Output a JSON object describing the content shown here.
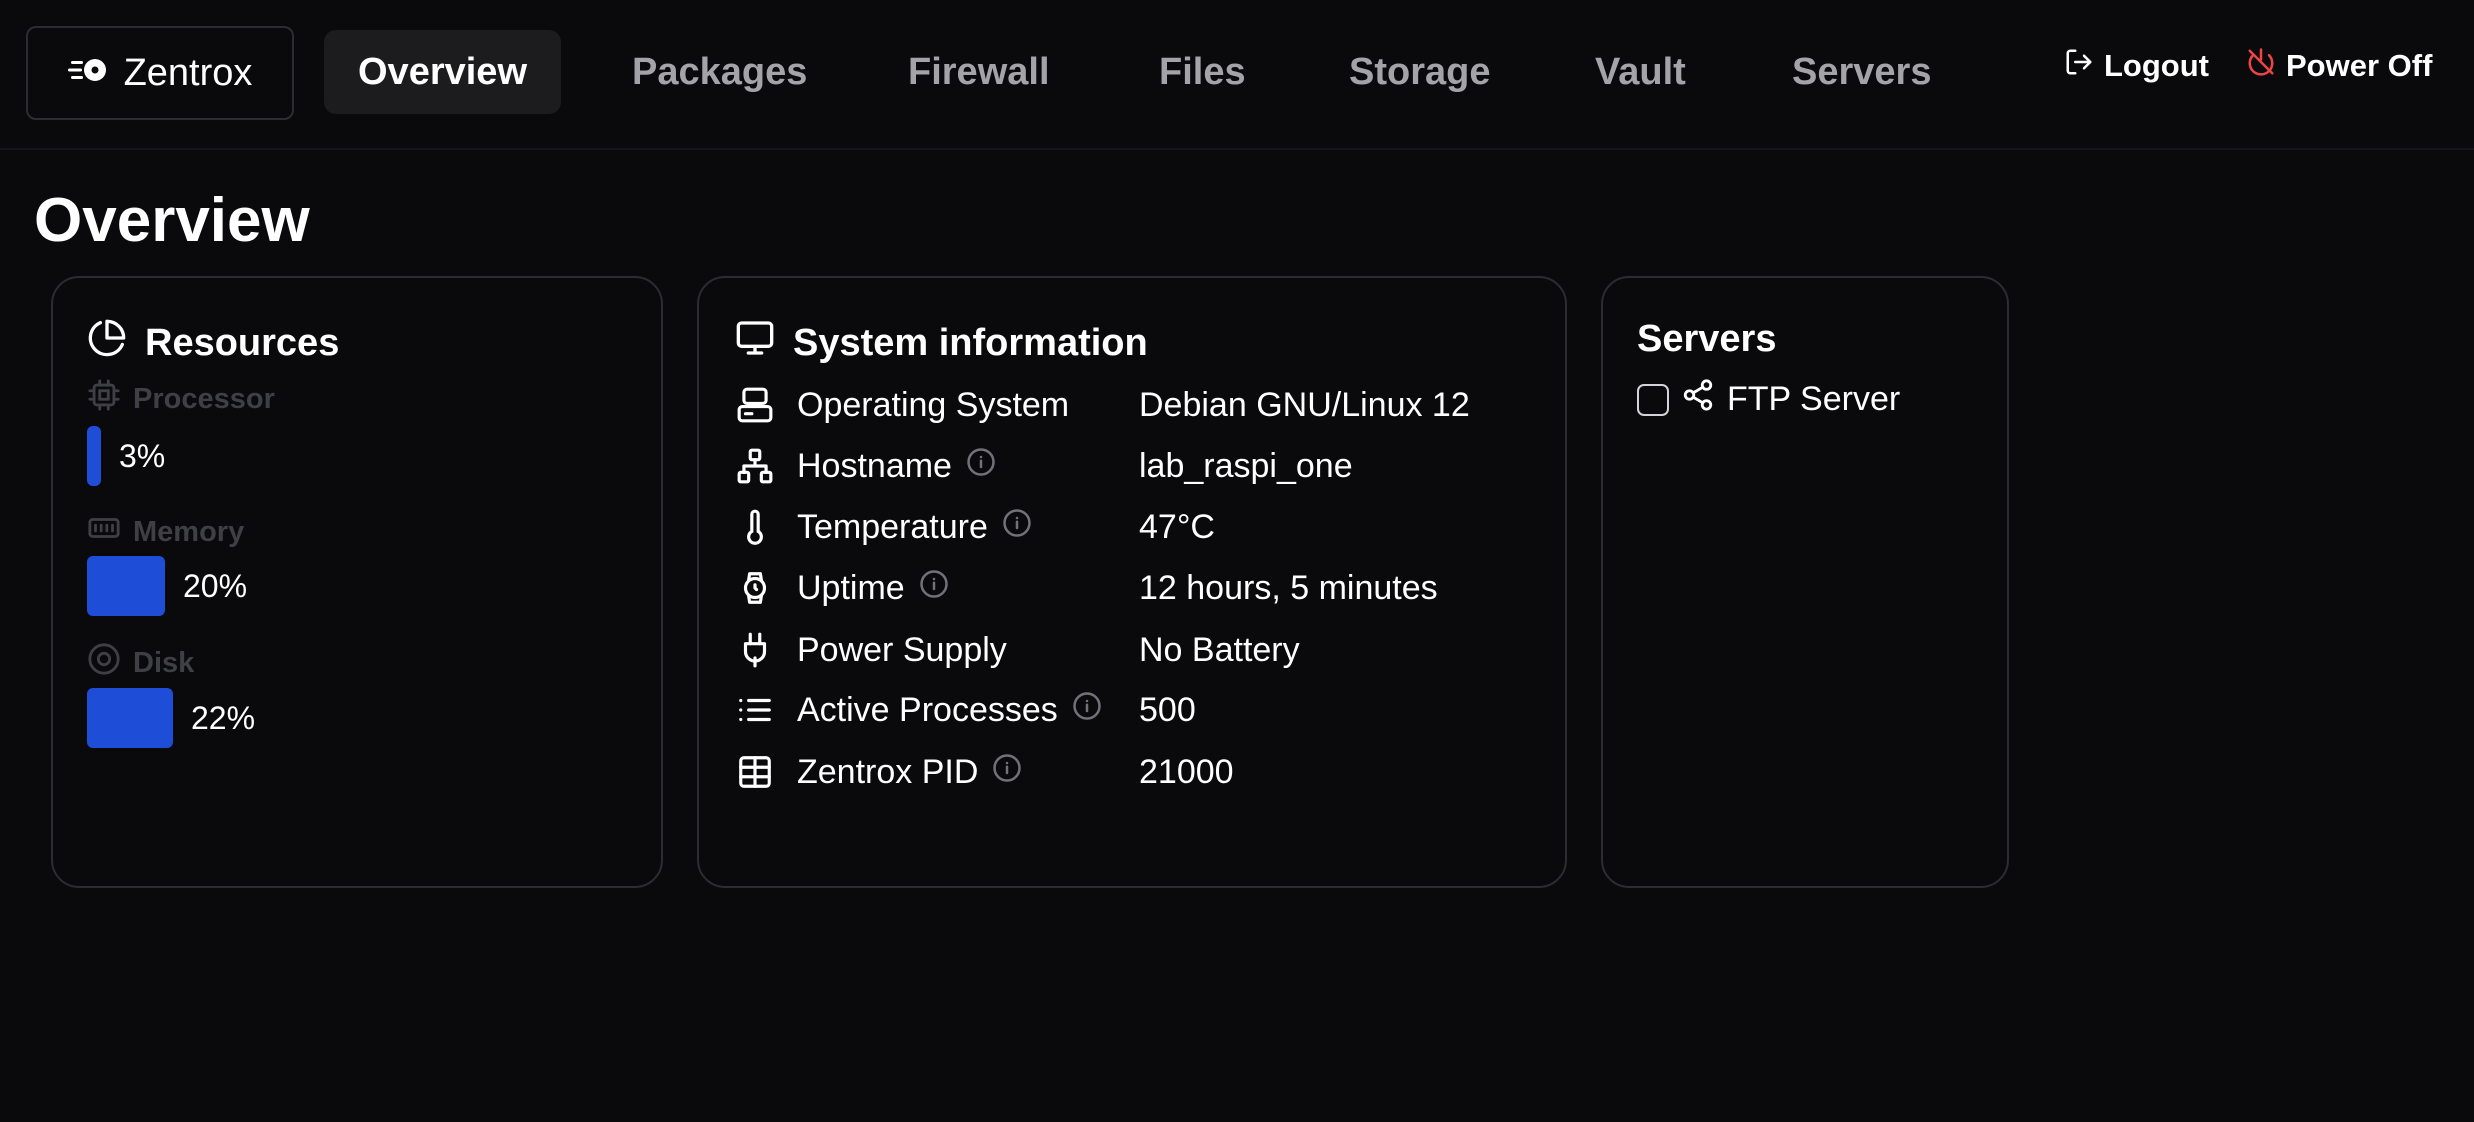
{
  "brand": {
    "name": "Zentrox",
    "icon": "zentrox-logo-icon"
  },
  "nav": {
    "items": [
      {
        "label": "Overview",
        "active": true
      },
      {
        "label": "Packages"
      },
      {
        "label": "Firewall"
      },
      {
        "label": "Files"
      },
      {
        "label": "Storage"
      },
      {
        "label": "Vault"
      },
      {
        "label": "Servers"
      }
    ]
  },
  "actions": {
    "logout": {
      "label": "Logout",
      "icon": "logout-icon"
    },
    "power_off": {
      "label": "Power Off",
      "icon": "power-off-icon",
      "color": "#ef4444"
    }
  },
  "page": {
    "title": "Overview"
  },
  "resources": {
    "title": "Resources",
    "processor": {
      "label": "Processor",
      "percent": 3,
      "display": "3%"
    },
    "memory": {
      "label": "Memory",
      "percent": 20,
      "display": "20%"
    },
    "disk": {
      "label": "Disk",
      "percent": 22,
      "display": "22%"
    },
    "bar_color": "#1e4ed8"
  },
  "system_info": {
    "title": "System information",
    "rows": [
      {
        "label": "Operating System",
        "value": "Debian GNU/Linux 12",
        "icon": "server-icon",
        "info": false
      },
      {
        "label": "Hostname",
        "value": "lab_raspi_one",
        "icon": "network-icon",
        "info": true
      },
      {
        "label": "Temperature",
        "value": "47°C",
        "icon": "thermometer-icon",
        "info": true
      },
      {
        "label": "Uptime",
        "value": "12 hours, 5 minutes",
        "icon": "watch-icon",
        "info": true
      },
      {
        "label": "Power Supply",
        "value": "No Battery",
        "icon": "plug-icon",
        "info": false
      },
      {
        "label": "Active Processes",
        "value": "500",
        "icon": "list-icon",
        "info": true
      },
      {
        "label": "Zentrox PID",
        "value": "21000",
        "icon": "table-icon",
        "info": true
      }
    ]
  },
  "servers": {
    "title": "Servers",
    "items": [
      {
        "label": "FTP Server",
        "checked": false,
        "icon": "share-icon"
      }
    ]
  }
}
